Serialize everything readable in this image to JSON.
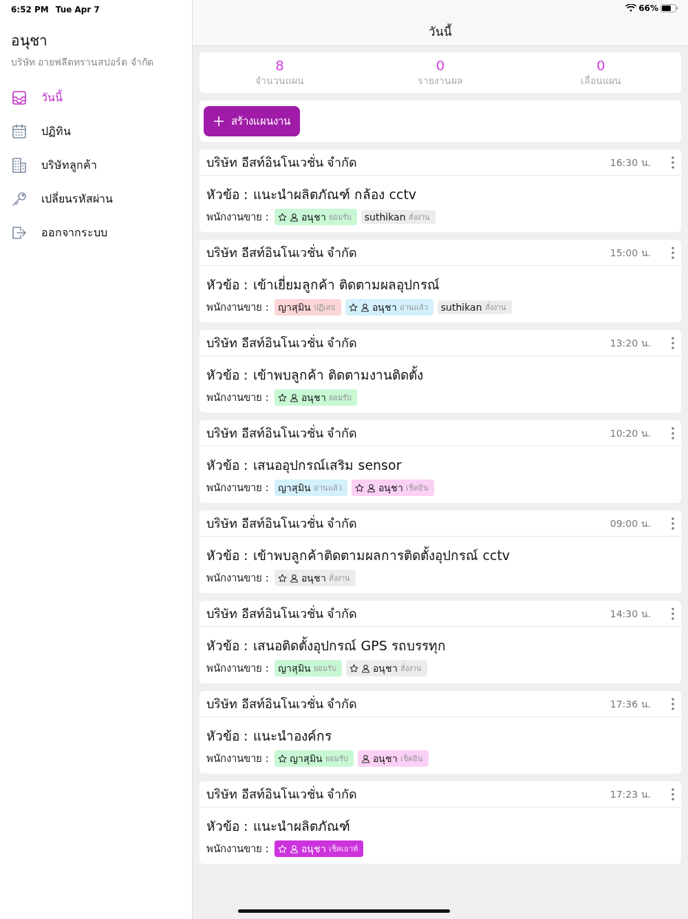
{
  "status_bar": {
    "time": "6:52 PM",
    "date": "Tue Apr 7",
    "battery_text": "66%"
  },
  "sidebar": {
    "user_name": "อนุชา",
    "company": "บริษัท อายฟลีตทรานสปอร์ต จำกัด",
    "items": [
      {
        "label": "วันนี้",
        "kind": "inbox",
        "selected": true
      },
      {
        "label": "ปฏิทิน",
        "kind": "calendar",
        "selected": false
      },
      {
        "label": "บริษัทลูกค้า",
        "kind": "building",
        "selected": false
      },
      {
        "label": "เปลี่ยนรหัสผ่าน",
        "kind": "key",
        "selected": false
      },
      {
        "label": "ออกจากระบบ",
        "kind": "logout",
        "selected": false
      }
    ]
  },
  "header": {
    "title": "วันนี้"
  },
  "stats": [
    {
      "value": "8",
      "label": "จำนวนแผน"
    },
    {
      "value": "0",
      "label": "รายงานผล"
    },
    {
      "value": "0",
      "label": "เลื่อนแผน"
    }
  ],
  "create_button": {
    "label": "สร้างแผนงาน"
  },
  "plans": [
    {
      "company": "บริษัท อีสท์อินโนเวชั่น จำกัด",
      "time": "16:30 น.",
      "topic_label": "หัวข้อ :",
      "topic": "แนะนำผลิตภัณฑ์ กล้อง cctv",
      "staff_label": "พนักงานขาย :",
      "tags": [
        {
          "name": "อนุชา",
          "status": "ยอมรับ",
          "star": true,
          "person": true,
          "color": "#c8f7d4"
        },
        {
          "name": "suthikan",
          "status": "สั่งงาน",
          "star": false,
          "person": false,
          "color": "#ececec"
        }
      ]
    },
    {
      "company": "บริษัท อีสท์อินโนเวชั่น จำกัด",
      "time": "15:00 น.",
      "topic_label": "หัวข้อ :",
      "topic": "เข้าเยี่ยมลูกค้า ติดตามผลอุปกรณ์",
      "staff_label": "พนักงานขาย :",
      "tags": [
        {
          "name": "ญาสุมิน",
          "status": "ปฏิเสธ",
          "star": false,
          "person": false,
          "color": "#fbd5d7"
        },
        {
          "name": "อนุชา",
          "status": "อ่านแล้ว",
          "star": true,
          "person": true,
          "color": "#d3f0fb"
        },
        {
          "name": "suthikan",
          "status": "สั่งงาน",
          "star": false,
          "person": false,
          "color": "#ececec"
        }
      ]
    },
    {
      "company": "บริษัท อีสท์อินโนเวชั่น จำกัด",
      "time": "13:20 น.",
      "topic_label": "หัวข้อ :",
      "topic": "เข้าพบลูกค้า ติดตามงานติดตั้ง",
      "staff_label": "พนักงานขาย :",
      "tags": [
        {
          "name": "อนุชา",
          "status": "ยอมรับ",
          "star": true,
          "person": true,
          "color": "#c8f7d4"
        }
      ]
    },
    {
      "company": "บริษัท อีสท์อินโนเวชั่น จำกัด",
      "time": "10:20 น.",
      "topic_label": "หัวข้อ :",
      "topic": "เสนออุปกรณ์เสริม sensor",
      "staff_label": "พนักงานขาย :",
      "tags": [
        {
          "name": "ญาสุมิน",
          "status": "อ่านแล้ว",
          "star": false,
          "person": false,
          "color": "#d3f0fb"
        },
        {
          "name": "อนุชา",
          "status": "เช็คอิน",
          "star": true,
          "person": true,
          "color": "#fbd0f5"
        }
      ]
    },
    {
      "company": "บริษัท อีสท์อินโนเวชั่น จำกัด",
      "time": "09:00 น.",
      "topic_label": "หัวข้อ :",
      "topic": "เข้าพบลูกค้าติดตามผลการติดตั้งอุปกรณ์ cctv",
      "staff_label": "พนักงานขาย :",
      "tags": [
        {
          "name": "อนุชา",
          "status": "สั่งงาน",
          "star": true,
          "person": true,
          "color": "#ececec"
        }
      ]
    },
    {
      "company": "บริษัท อีสท์อินโนเวชั่น จำกัด",
      "time": "14:30 น.",
      "topic_label": "หัวข้อ :",
      "topic": "เสนอติดตั้งอุปกรณ์ GPS รถบรรทุก",
      "staff_label": "พนักงานขาย :",
      "tags": [
        {
          "name": "ญาสุมิน",
          "status": "ยอมรับ",
          "star": false,
          "person": false,
          "color": "#c8f7d4"
        },
        {
          "name": "อนุชา",
          "status": "สั่งงาน",
          "star": true,
          "person": true,
          "color": "#ececec"
        }
      ]
    },
    {
      "company": "บริษัท อีสท์อินโนเวชั่น จำกัด",
      "time": "17:36 น.",
      "topic_label": "หัวข้อ :",
      "topic": "แนะนำองค์กร",
      "staff_label": "พนักงานขาย :",
      "tags": [
        {
          "name": "ญาสุมิน",
          "status": "ยอมรับ",
          "star": true,
          "person": false,
          "color": "#c8f7d4"
        },
        {
          "name": "อนุชา",
          "status": "เช็คอิน",
          "star": false,
          "person": true,
          "color": "#fbd0f5"
        }
      ]
    },
    {
      "company": "บริษัท อีสท์อินโนเวชั่น จำกัด",
      "time": "17:23 น.",
      "topic_label": "หัวข้อ :",
      "topic": "แนะนำผลิตภัณฑ์",
      "staff_label": "พนักงานขาย :",
      "tags": [
        {
          "name": "อนุชา",
          "status": "เช็คเอาท์",
          "star": true,
          "person": true,
          "color": "#cc33dd"
        }
      ]
    }
  ]
}
